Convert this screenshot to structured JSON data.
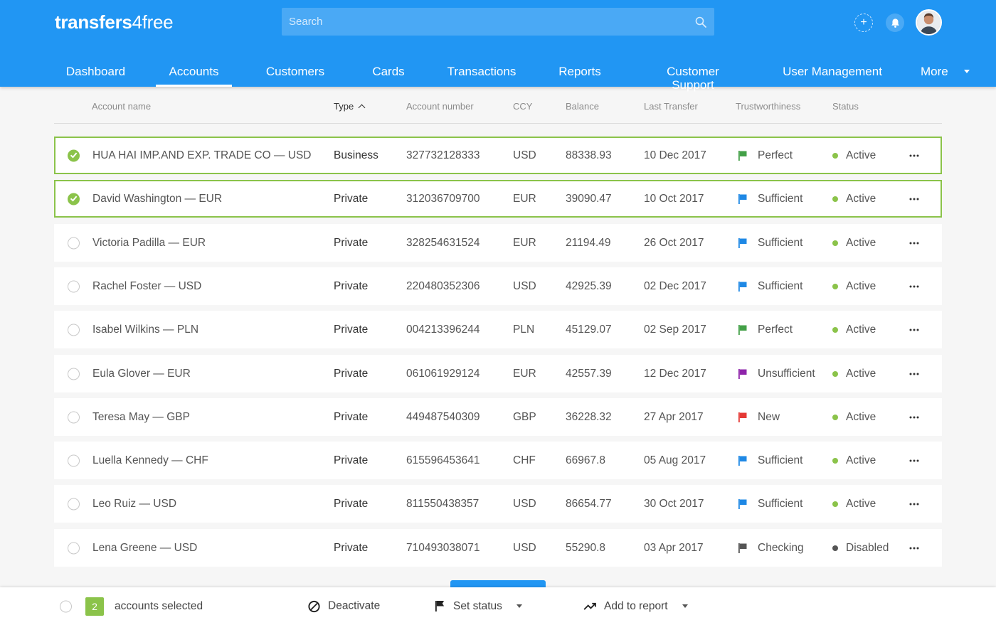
{
  "brand": {
    "bold": "transfers",
    "light": "4free"
  },
  "search": {
    "placeholder": "Search"
  },
  "nav": [
    {
      "label": "Dashboard"
    },
    {
      "label": "Accounts"
    },
    {
      "label": "Customers"
    },
    {
      "label": "Cards"
    },
    {
      "label": "Transactions"
    },
    {
      "label": "Reports"
    },
    {
      "label": "Customer Support"
    },
    {
      "label": "User Management"
    },
    {
      "label": "More"
    }
  ],
  "columns": {
    "account_name": "Account name",
    "type": "Type",
    "account_number": "Account number",
    "ccy": "CCY",
    "balance": "Balance",
    "last_transfer": "Last Transfer",
    "trustworthiness": "Trustworthiness",
    "status": "Status"
  },
  "colors": {
    "brand_blue": "#2196f3",
    "selected_green": "#8bc34a",
    "flag_green": "#43a047",
    "flag_blue": "#1e88e5",
    "flag_purple": "#8e24aa",
    "flag_red": "#e53935",
    "flag_gray": "#555555",
    "status_active": "#8bc34a",
    "status_disabled": "#555555"
  },
  "rows": [
    {
      "selected": true,
      "name": "HUA HAI IMP.AND EXP. TRADE CO — USD",
      "type": "Business",
      "number": "327732128333",
      "ccy": "USD",
      "balance": "88338.93",
      "last_transfer": "10 Dec 2017",
      "trust": "Perfect",
      "trust_color": "#43a047",
      "status": "Active",
      "status_color": "#8bc34a"
    },
    {
      "selected": true,
      "name": "David Washington — EUR",
      "type": "Private",
      "number": "312036709700",
      "ccy": "EUR",
      "balance": "39090.47",
      "last_transfer": "10 Oct 2017",
      "trust": "Sufficient",
      "trust_color": "#1e88e5",
      "status": "Active",
      "status_color": "#8bc34a"
    },
    {
      "selected": false,
      "name": "Victoria Padilla — EUR",
      "type": "Private",
      "number": "328254631524",
      "ccy": "EUR",
      "balance": "21194.49",
      "last_transfer": "26 Oct 2017",
      "trust": "Sufficient",
      "trust_color": "#1e88e5",
      "status": "Active",
      "status_color": "#8bc34a"
    },
    {
      "selected": false,
      "name": "Rachel Foster — USD",
      "type": "Private",
      "number": "220480352306",
      "ccy": "USD",
      "balance": "42925.39",
      "last_transfer": "02 Dec 2017",
      "trust": "Sufficient",
      "trust_color": "#1e88e5",
      "status": "Active",
      "status_color": "#8bc34a"
    },
    {
      "selected": false,
      "name": "Isabel Wilkins — PLN",
      "type": "Private",
      "number": "004213396244",
      "ccy": "PLN",
      "balance": "45129.07",
      "last_transfer": "02 Sep 2017",
      "trust": "Perfect",
      "trust_color": "#43a047",
      "status": "Active",
      "status_color": "#8bc34a"
    },
    {
      "selected": false,
      "name": "Eula Glover — EUR",
      "type": "Private",
      "number": "061061929124",
      "ccy": "EUR",
      "balance": "42557.39",
      "last_transfer": "12 Dec 2017",
      "trust": "Unsufficient",
      "trust_color": "#8e24aa",
      "status": "Active",
      "status_color": "#8bc34a"
    },
    {
      "selected": false,
      "name": "Teresa May — GBP",
      "type": "Private",
      "number": "449487540309",
      "ccy": "GBP",
      "balance": "36228.32",
      "last_transfer": "27 Apr 2017",
      "trust": "New",
      "trust_color": "#e53935",
      "status": "Active",
      "status_color": "#8bc34a"
    },
    {
      "selected": false,
      "name": "Luella Kennedy — CHF",
      "type": "Private",
      "number": "615596453641",
      "ccy": "CHF",
      "balance": "66967.8",
      "last_transfer": "05 Aug 2017",
      "trust": "Sufficient",
      "trust_color": "#1e88e5",
      "status": "Active",
      "status_color": "#8bc34a"
    },
    {
      "selected": false,
      "name": "Leo Ruiz — USD",
      "type": "Private",
      "number": "811550438357",
      "ccy": "USD",
      "balance": "86654.77",
      "last_transfer": "30 Oct 2017",
      "trust": "Sufficient",
      "trust_color": "#1e88e5",
      "status": "Active",
      "status_color": "#8bc34a"
    },
    {
      "selected": false,
      "name": "Lena Greene — USD",
      "type": "Private",
      "number": "710493038071",
      "ccy": "USD",
      "balance": "55290.8",
      "last_transfer": "03 Apr 2017",
      "trust": "Checking",
      "trust_color": "#555555",
      "status": "Disabled",
      "status_color": "#555555"
    }
  ],
  "bulk": {
    "count": "2",
    "selected_label": "accounts selected",
    "deactivate": "Deactivate",
    "set_status": "Set status",
    "add_to_report": "Add to report"
  }
}
